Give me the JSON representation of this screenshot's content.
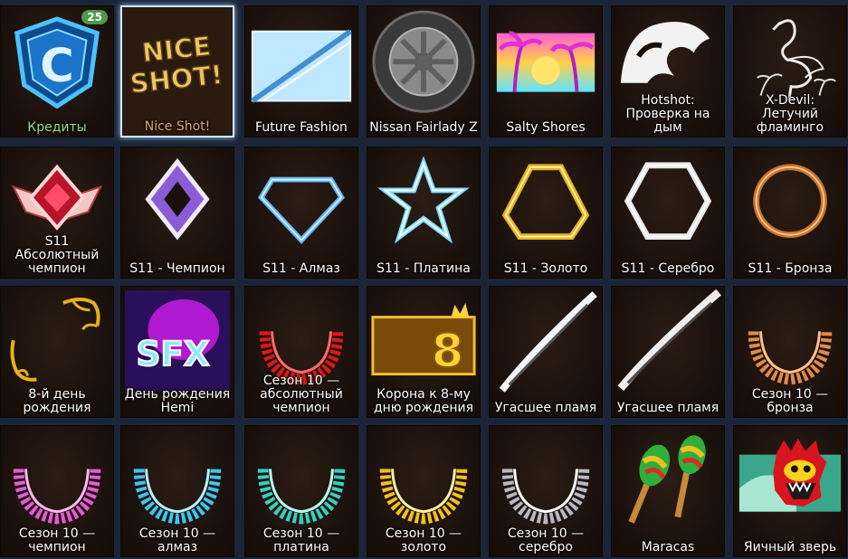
{
  "items": [
    {
      "name": "Кредиты",
      "icon": "credits-shield-icon",
      "badge": "25"
    },
    {
      "name": "Nice Shot!",
      "icon": "nice-shot-decal-icon"
    },
    {
      "name": "Future Fashion",
      "icon": "glass-banner-icon"
    },
    {
      "name": "Nissan Fairlady Z",
      "icon": "tire-wheel-icon"
    },
    {
      "name": "Salty Shores",
      "icon": "palm-beach-icon"
    },
    {
      "name": "Hotshot:\nПроверка на\nдым",
      "icon": "smoke-trail-icon"
    },
    {
      "name": "X-Devil: Летучий\nфламинго",
      "icon": "flamingo-icon"
    },
    {
      "name": "S11\nАбсолютный\nчемпион",
      "icon": "grand-champion-rank-icon"
    },
    {
      "name": "S11 - Чемпион",
      "icon": "champion-rank-icon"
    },
    {
      "name": "S11 - Алмаз",
      "icon": "diamond-rank-icon"
    },
    {
      "name": "S11 - Платина",
      "icon": "platinum-star-icon"
    },
    {
      "name": "S11 - Золото",
      "icon": "gold-triangle-icon"
    },
    {
      "name": "S11 - Серебро",
      "icon": "silver-hexagon-icon"
    },
    {
      "name": "S11 - Бронза",
      "icon": "bronze-ring-icon"
    },
    {
      "name": "8-й день\nрождения",
      "icon": "ornate-frame-icon"
    },
    {
      "name": "День рождения\nHemi",
      "icon": "sfx-banner-icon"
    },
    {
      "name": "Сезон 10 —\nабсолютный\nчемпион",
      "icon": "red-particle-ring-icon"
    },
    {
      "name": "Корона к 8-му\nдню рождения",
      "icon": "crown-eight-banner-icon"
    },
    {
      "name": "Угасшее пламя",
      "icon": "fading-flame-icon"
    },
    {
      "name": "Угасшее пламя",
      "icon": "fading-flame-icon"
    },
    {
      "name": "Сезон 10 —\nбронза",
      "icon": "bronze-particle-ring-icon"
    },
    {
      "name": "Сезон 10 —\nчемпион",
      "icon": "pink-particle-ring-icon"
    },
    {
      "name": "Сезон 10 —\nалмаз",
      "icon": "cyan-particle-ring-icon"
    },
    {
      "name": "Сезон 10 —\nплатина",
      "icon": "teal-particle-ring-icon"
    },
    {
      "name": "Сезон 10 —\nзолото",
      "icon": "gold-particle-ring-icon"
    },
    {
      "name": "Сезон 10 —\nсеребро",
      "icon": "silver-particle-ring-icon"
    },
    {
      "name": "Maracas",
      "icon": "maracas-icon"
    },
    {
      "name": "Яичный зверь",
      "icon": "egg-beast-icon"
    }
  ],
  "selected_index": 1
}
